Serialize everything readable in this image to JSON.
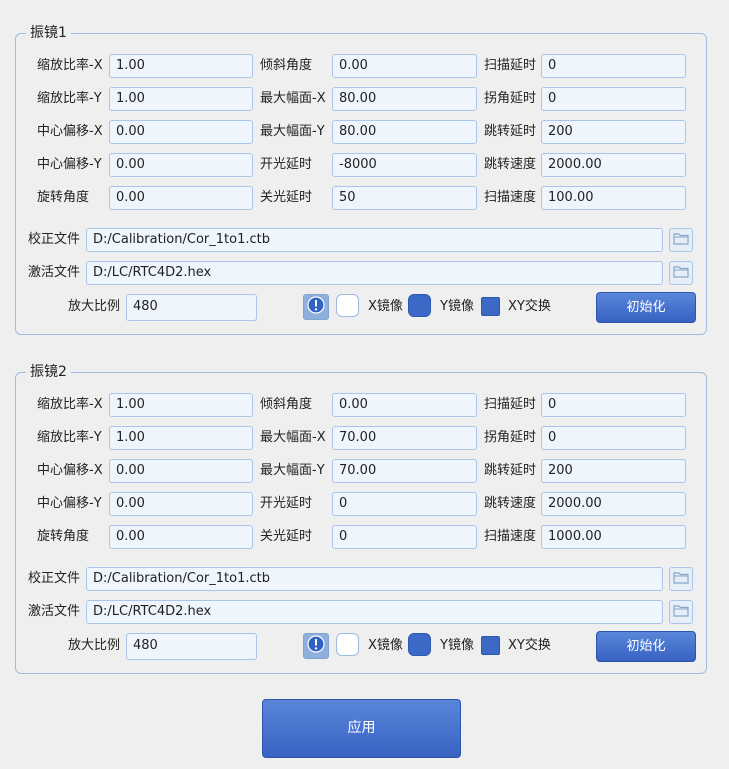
{
  "galvo1": {
    "title": "振镜1",
    "fields": [
      {
        "label": "缩放比率-X",
        "value": "1.00"
      },
      {
        "label": "倾斜角度",
        "value": "0.00"
      },
      {
        "label": "扫描延时",
        "value": "0"
      },
      {
        "label": "缩放比率-Y",
        "value": "1.00"
      },
      {
        "label": "最大幅面-X",
        "value": "80.00"
      },
      {
        "label": "拐角延时",
        "value": "0"
      },
      {
        "label": "中心偏移-X",
        "value": "0.00"
      },
      {
        "label": "最大幅面-Y",
        "value": "80.00"
      },
      {
        "label": "跳转延时",
        "value": "200"
      },
      {
        "label": "中心偏移-Y",
        "value": "0.00"
      },
      {
        "label": "开光延时",
        "value": "-8000"
      },
      {
        "label": "跳转速度",
        "value": "2000.00"
      },
      {
        "label": "旋转角度",
        "value": "0.00"
      },
      {
        "label": "关光延时",
        "value": "50"
      },
      {
        "label": "扫描速度",
        "value": "100.00"
      }
    ],
    "cal_label": "校正文件",
    "cal_value": "D:/Calibration/Cor_1to1.ctb",
    "act_label": "激活文件",
    "act_value": "D:/LC/RTC4D2.hex",
    "zoom_label": "放大比例",
    "zoom_value": "480",
    "x_mirror_label": "X镜像",
    "x_mirror_checked": false,
    "y_mirror_label": "Y镜像",
    "y_mirror_checked": true,
    "xy_swap_label": "XY交换",
    "xy_swap_checked": true,
    "init_label": "初始化"
  },
  "galvo2": {
    "title": "振镜2",
    "fields": [
      {
        "label": "缩放比率-X",
        "value": "1.00"
      },
      {
        "label": "倾斜角度",
        "value": "0.00"
      },
      {
        "label": "扫描延时",
        "value": "0"
      },
      {
        "label": "缩放比率-Y",
        "value": "1.00"
      },
      {
        "label": "最大幅面-X",
        "value": "70.00"
      },
      {
        "label": "拐角延时",
        "value": "0"
      },
      {
        "label": "中心偏移-X",
        "value": "0.00"
      },
      {
        "label": "最大幅面-Y",
        "value": "70.00"
      },
      {
        "label": "跳转延时",
        "value": "200"
      },
      {
        "label": "中心偏移-Y",
        "value": "0.00"
      },
      {
        "label": "开光延时",
        "value": "0"
      },
      {
        "label": "跳转速度",
        "value": "2000.00"
      },
      {
        "label": "旋转角度",
        "value": "0.00"
      },
      {
        "label": "关光延时",
        "value": "0"
      },
      {
        "label": "扫描速度",
        "value": "1000.00"
      }
    ],
    "cal_label": "校正文件",
    "cal_value": "D:/Calibration/Cor_1to1.ctb",
    "act_label": "激活文件",
    "act_value": "D:/LC/RTC4D2.hex",
    "zoom_label": "放大比例",
    "zoom_value": "480",
    "x_mirror_label": "X镜像",
    "x_mirror_checked": false,
    "y_mirror_label": "Y镜像",
    "y_mirror_checked": true,
    "xy_swap_label": "XY交换",
    "xy_swap_checked": true,
    "init_label": "初始化"
  },
  "apply_label": "应用",
  "icons": {
    "folder": "folder-icon",
    "info": "info-icon"
  }
}
